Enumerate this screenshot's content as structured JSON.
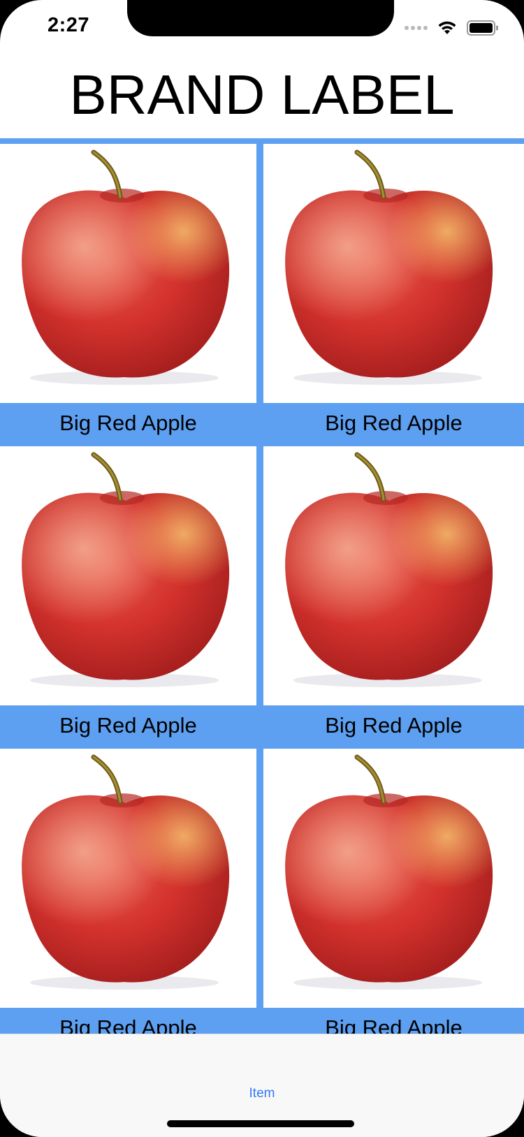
{
  "status_bar": {
    "time": "2:27",
    "icons": [
      "signal-dots-icon",
      "wifi-icon",
      "battery-icon"
    ]
  },
  "header": {
    "title": "BRAND LABEL"
  },
  "grid": {
    "items": [
      {
        "caption": "Big Red Apple",
        "image": "red-apple"
      },
      {
        "caption": "Big Red Apple",
        "image": "red-apple"
      },
      {
        "caption": "Big Red Apple",
        "image": "red-apple"
      },
      {
        "caption": "Big Red Apple",
        "image": "red-apple"
      },
      {
        "caption": "Big Red Apple",
        "image": "red-apple"
      },
      {
        "caption": "Big Red Apple",
        "image": "red-apple"
      }
    ]
  },
  "tab_bar": {
    "items": [
      {
        "label": "Item",
        "selected": true
      }
    ]
  },
  "colors": {
    "accent_blue": "#5d9ff0",
    "tab_tint": "#3478f6",
    "apple_red": "#d7322b"
  }
}
